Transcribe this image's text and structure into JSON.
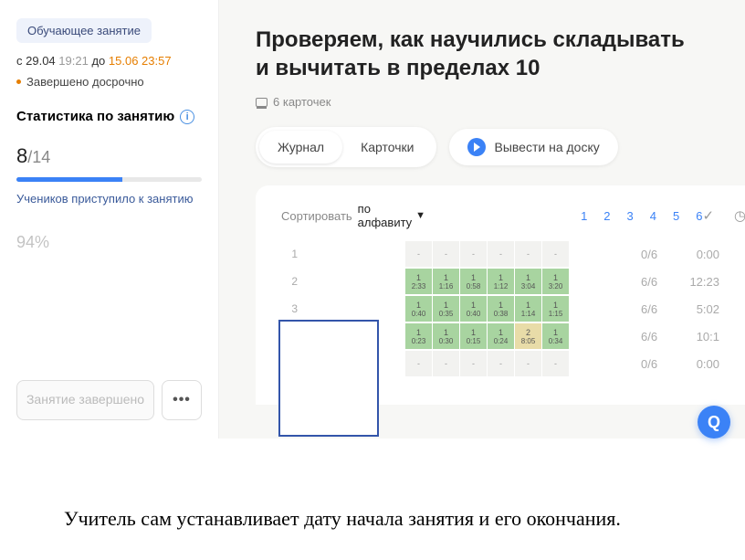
{
  "sidebar": {
    "badge": "Обучающее занятие",
    "date_from_prefix": "с ",
    "date_from": "29.04",
    "time_from": "19:21",
    "date_to_prefix": "до ",
    "date_to": "15.06 23:57",
    "status": "Завершено досрочно",
    "stats_title": "Статистика по занятию",
    "fraction_num": "8",
    "fraction_sep": "/",
    "fraction_den": "14",
    "progress_label": "Учеников приступило к занятию",
    "pct": "94%",
    "done_btn": "Занятие завершено",
    "more_btn": "•••"
  },
  "main": {
    "title": "Проверяем, как научились складывать и вычитать в пределах 10",
    "cards": "6 карточек",
    "tab_journal": "Журнал",
    "tab_cards": "Карточки",
    "broadcast": "Вывести на доску",
    "sort_label": "Сортировать",
    "sort_value": "по алфавиту",
    "cols": [
      "1",
      "2",
      "3",
      "4",
      "5",
      "6"
    ],
    "check_icon": "✓",
    "clock_icon": "◷",
    "rows": [
      {
        "n": "1",
        "cells": [
          {
            "c": "e",
            "t": "-"
          },
          {
            "c": "e",
            "t": "-"
          },
          {
            "c": "e",
            "t": "-"
          },
          {
            "c": "e",
            "t": "-"
          },
          {
            "c": "e",
            "t": "-"
          },
          {
            "c": "e",
            "t": "-"
          }
        ],
        "score": "0/6",
        "time": "0:00"
      },
      {
        "n": "2",
        "cells": [
          {
            "c": "g",
            "t": "1",
            "b": "2:33"
          },
          {
            "c": "g",
            "t": "1",
            "b": "1:16"
          },
          {
            "c": "g",
            "t": "1",
            "b": "0:58"
          },
          {
            "c": "g",
            "t": "1",
            "b": "1:12"
          },
          {
            "c": "g",
            "t": "1",
            "b": "3:04"
          },
          {
            "c": "g",
            "t": "1",
            "b": "3:20"
          }
        ],
        "score": "6/6",
        "time": "12:23"
      },
      {
        "n": "3",
        "cells": [
          {
            "c": "g",
            "t": "1",
            "b": "0:40"
          },
          {
            "c": "g",
            "t": "1",
            "b": "0:35"
          },
          {
            "c": "g",
            "t": "1",
            "b": "0:40"
          },
          {
            "c": "g",
            "t": "1",
            "b": "0:38"
          },
          {
            "c": "g",
            "t": "1",
            "b": "1:14"
          },
          {
            "c": "g",
            "t": "1",
            "b": "1:15"
          }
        ],
        "score": "6/6",
        "time": "5:02"
      },
      {
        "n": "4",
        "cells": [
          {
            "c": "g",
            "t": "1",
            "b": "0:23"
          },
          {
            "c": "g",
            "t": "1",
            "b": "0:30"
          },
          {
            "c": "g",
            "t": "1",
            "b": "0:15"
          },
          {
            "c": "g",
            "t": "1",
            "b": "0:24"
          },
          {
            "c": "y",
            "t": "2",
            "b": "8:05"
          },
          {
            "c": "g",
            "t": "1",
            "b": "0:34"
          }
        ],
        "score": "6/6",
        "time": "10:1"
      },
      {
        "n": "5",
        "cells": [
          {
            "c": "e",
            "t": "-"
          },
          {
            "c": "e",
            "t": "-"
          },
          {
            "c": "e",
            "t": "-"
          },
          {
            "c": "e",
            "t": "-"
          },
          {
            "c": "e",
            "t": "-"
          },
          {
            "c": "e",
            "t": "-"
          }
        ],
        "score": "0/6",
        "time": "0:00"
      }
    ]
  },
  "fab": "Q",
  "caption": "Учитель сам устанавливает дату  начала занятия и его окончания."
}
